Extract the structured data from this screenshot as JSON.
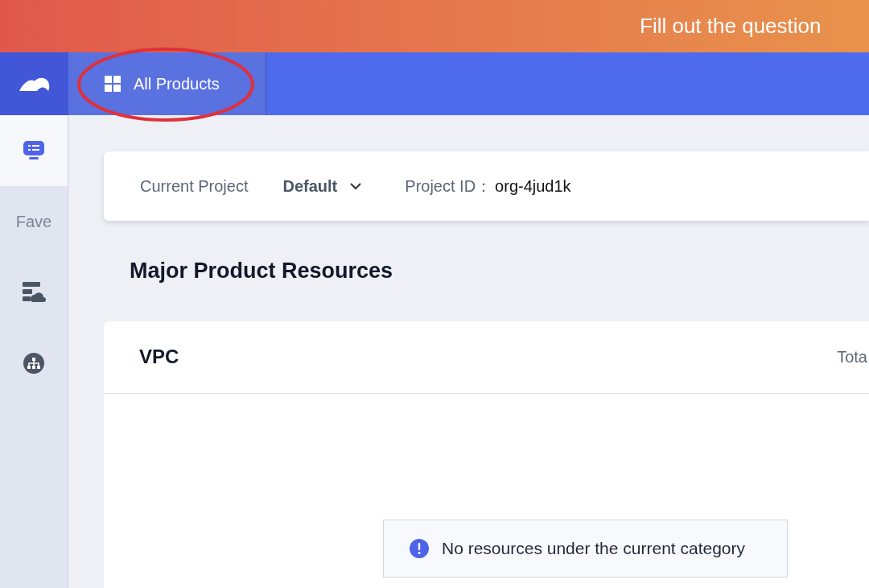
{
  "banner": {
    "text": "Fill out the question"
  },
  "top_nav": {
    "items": [
      {
        "label": "All Products",
        "selected": true,
        "highlighted": true
      }
    ]
  },
  "sidebar": {
    "items": [
      {
        "kind": "icon",
        "selected": true
      },
      {
        "kind": "text",
        "label": "Fave",
        "selected": false
      },
      {
        "kind": "icon",
        "selected": false
      },
      {
        "kind": "icon",
        "selected": false
      }
    ]
  },
  "project_bar": {
    "label": "Current Project",
    "project": "Default",
    "id_label": "Project ID：",
    "id_value": "org-4jud1k"
  },
  "section_title": "Major Product Resources",
  "resource_card": {
    "title": "VPC",
    "total": "Tota",
    "empty_message": "No resources under the current category"
  }
}
